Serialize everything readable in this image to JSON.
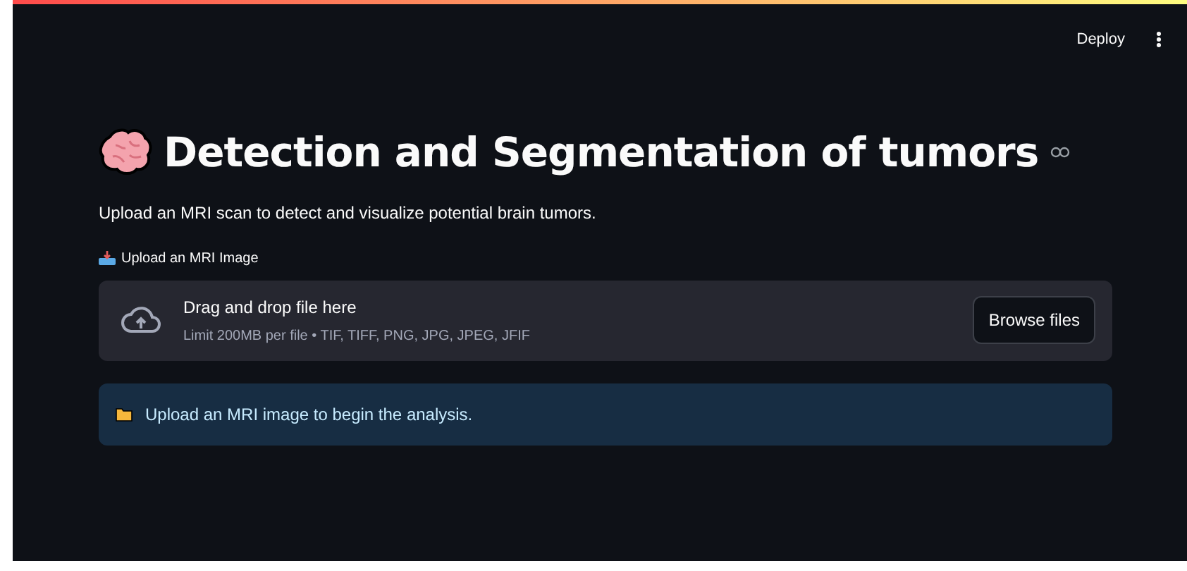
{
  "header": {
    "deploy": "Deploy"
  },
  "title": "Detection and Segmentation of tumors",
  "intro": "Upload an MRI scan to detect and visualize potential brain tumors.",
  "uploader": {
    "label": "Upload an MRI Image",
    "drop_text": "Drag and drop file here",
    "limit": "Limit 200MB per file • TIF, TIFF, PNG, JPG, JPEG, JFIF",
    "button": "Browse files"
  },
  "info": "Upload an MRI image to begin the analysis."
}
